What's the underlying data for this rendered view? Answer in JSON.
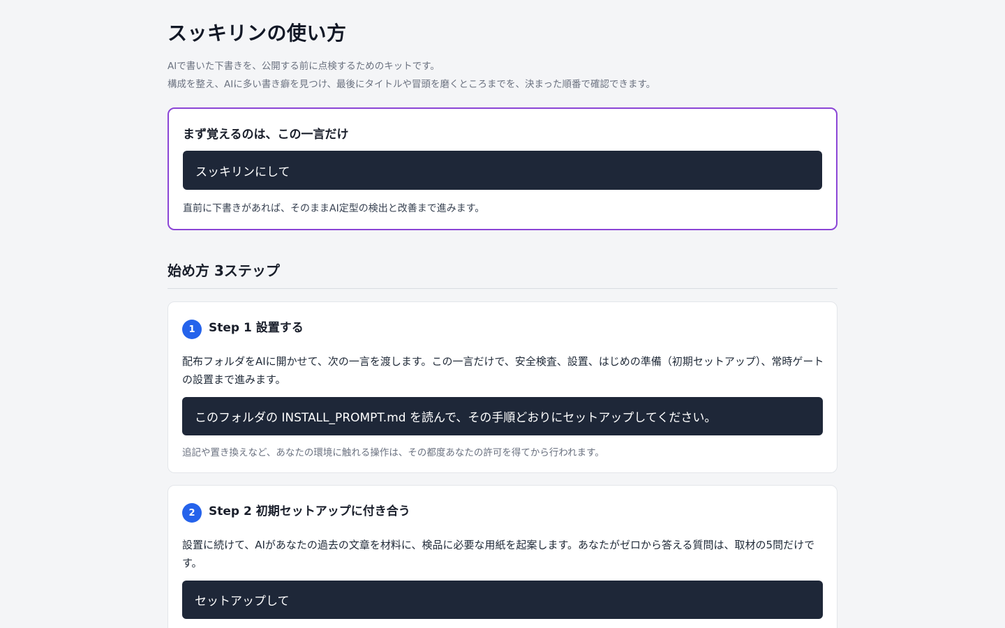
{
  "header": {
    "title": "スッキリンの使い方",
    "lead_line1": "AIで書いた下書きを、公開する前に点検するためのキットです。",
    "lead_line2": "構成を整え、AIに多い書き癖を見つけ、最後にタイトルや冒頭を磨くところまでを、決まった順番で確認できます。"
  },
  "hero": {
    "heading": "まず覚えるのは、この一言だけ",
    "command": "スッキリンにして",
    "note": "直前に下書きがあれば、そのままAI定型の検出と改善まで進みます。"
  },
  "steps_section": {
    "title": "始め方 3ステップ",
    "steps": [
      {
        "number": "1",
        "title": "Step 1 設置する",
        "body": "配布フォルダをAIに開かせて、次の一言を渡します。この一言だけで、安全検査、設置、はじめの準備（初期セットアップ）、常時ゲートの設置まで進みます。",
        "command": "このフォルダの INSTALL_PROMPT.md を読んで、その手順どおりにセットアップしてください。",
        "fine": "追記や置き換えなど、あなたの環境に触れる操作は、その都度あなたの許可を得てから行われます。"
      },
      {
        "number": "2",
        "title": "Step 2 初期セットアップに付き合う",
        "body": "設置に続けて、AIがあなたの過去の文章を材料に、検品に必要な用紙を起案します。あなたがゼロから答える質問は、取材の5問だけです。",
        "command": "セットアップして"
      }
    ]
  }
}
